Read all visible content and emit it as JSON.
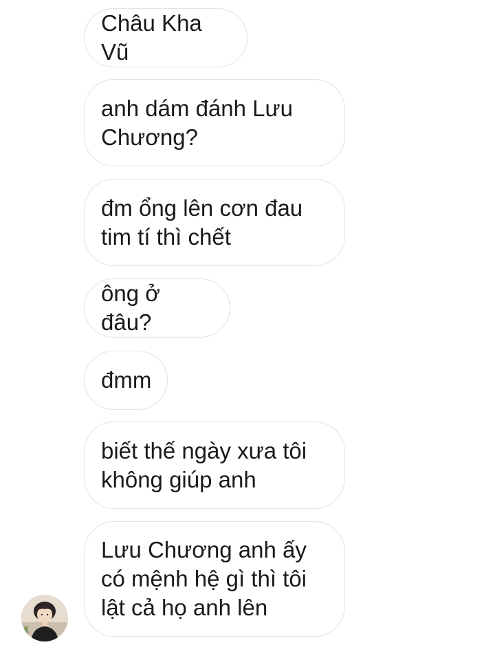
{
  "conversation": {
    "messages": [
      {
        "text": "Châu Kha Vũ"
      },
      {
        "text": "anh dám đánh Lưu\nChương?"
      },
      {
        "text": "đm ổng lên cơn đau\ntim tí thì chết"
      },
      {
        "text": "ông ở đâu?"
      },
      {
        "text": "đmm"
      },
      {
        "text": "biết thế ngày xưa tôi\nkhông giúp anh"
      },
      {
        "text": "Lưu Chương anh ấy\ncó mệnh hệ gì thì tôi\nlật cả họ anh lên"
      }
    ],
    "sender_avatar_icon": "user-avatar-photo"
  },
  "colors": {
    "background": "#ffffff",
    "bubble_border": "#e3e3e3",
    "text": "#1a1a1a"
  }
}
